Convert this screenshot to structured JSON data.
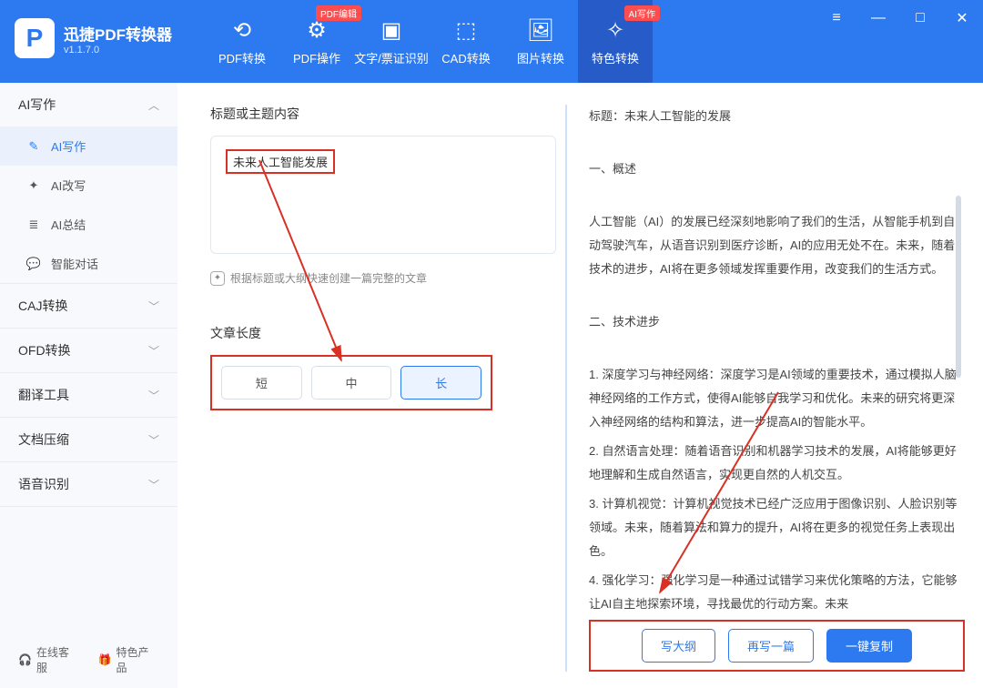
{
  "brand": {
    "name": "迅捷PDF转换器",
    "version": "v1.1.7.0"
  },
  "nav": [
    {
      "label": "PDF转换",
      "badge": ""
    },
    {
      "label": "PDF操作",
      "badge": "PDF编辑"
    },
    {
      "label": "文字/票证识别",
      "badge": ""
    },
    {
      "label": "CAD转换",
      "badge": ""
    },
    {
      "label": "图片转换",
      "badge": ""
    },
    {
      "label": "特色转换",
      "badge": "AI写作"
    }
  ],
  "sidebar": {
    "groups": [
      {
        "title": "AI写作",
        "expanded": true,
        "items": [
          {
            "label": "AI写作",
            "active": true,
            "icon": "✎"
          },
          {
            "label": "AI改写",
            "active": false,
            "icon": "✦"
          },
          {
            "label": "AI总结",
            "active": false,
            "icon": "≣"
          },
          {
            "label": "智能对话",
            "active": false,
            "icon": "✉"
          }
        ]
      },
      {
        "title": "CAJ转换",
        "expanded": false
      },
      {
        "title": "OFD转换",
        "expanded": false
      },
      {
        "title": "翻译工具",
        "expanded": false
      },
      {
        "title": "文档压缩",
        "expanded": false
      },
      {
        "title": "语音识别",
        "expanded": false
      }
    ],
    "footer": {
      "online": "在线客服",
      "feature": "特色产品"
    }
  },
  "main": {
    "topic_title": "标题或主题内容",
    "topic_value": "未来人工智能发展",
    "hint": "根据标题或大纲快速创建一篇完整的文章",
    "length_title": "文章长度",
    "length_opts": [
      "短",
      "中",
      "长"
    ],
    "output": {
      "title": "标题：未来人工智能的发展",
      "h1": "一、概述",
      "p1": "人工智能（AI）的发展已经深刻地影响了我们的生活，从智能手机到自动驾驶汽车，从语音识别到医疗诊断，AI的应用无处不在。未来，随着技术的进步，AI将在更多领域发挥重要作用，改变我们的生活方式。",
      "h2": "二、技术进步",
      "l1": "1. 深度学习与神经网络：深度学习是AI领域的重要技术，通过模拟人脑神经网络的工作方式，使得AI能够自我学习和优化。未来的研究将更深入神经网络的结构和算法，进一步提高AI的智能水平。",
      "l2": "2. 自然语言处理：随着语音识别和机器学习技术的发展，AI将能够更好地理解和生成自然语言，实现更自然的人机交互。",
      "l3": "3. 计算机视觉：计算机视觉技术已经广泛应用于图像识别、人脸识别等领域。未来，随着算法和算力的提升，AI将在更多的视觉任务上表现出色。",
      "l4": "4. 强化学习：强化学习是一种通过试错学习来优化策略的方法，它能够让AI自主地探索环境，寻找最优的行动方案。未来"
    },
    "actions": {
      "outline": "写大纲",
      "rewrite": "再写一篇",
      "copy": "一键复制"
    }
  }
}
